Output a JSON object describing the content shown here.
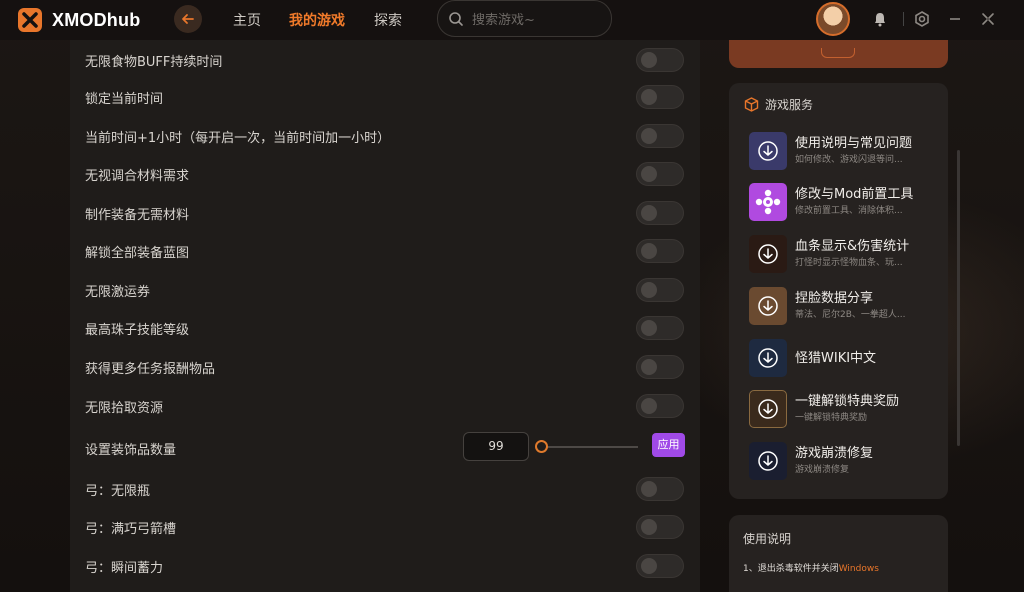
{
  "app": {
    "name": "XMODhub"
  },
  "nav": {
    "home": "主页",
    "my_games": "我的游戏",
    "explore": "探索"
  },
  "search": {
    "placeholder": "搜索游戏~"
  },
  "cheats": [
    {
      "label": "无限食物BUFF持续时间"
    },
    {
      "label": "锁定当前时间"
    },
    {
      "label": "当前时间+1小时（每开启一次，当前时间加一小时）"
    },
    {
      "label": "无视调合材料需求"
    },
    {
      "label": "制作装备无需材料"
    },
    {
      "label": "解锁全部装备蓝图"
    },
    {
      "label": "无限激运券"
    },
    {
      "label": "最高珠子技能等级"
    },
    {
      "label": "获得更多任务报酬物品"
    },
    {
      "label": "无限拾取资源"
    }
  ],
  "slider_row": {
    "label": "设置装饰品数量",
    "value": "99",
    "apply_label": "应用"
  },
  "cheats_bottom": [
    {
      "label": "弓：无限瓶"
    },
    {
      "label": "弓：满巧弓箭槽"
    },
    {
      "label": "弓：瞬间蓄力"
    }
  ],
  "services": {
    "title": "游戏服务",
    "items": [
      {
        "title": "使用说明与常见问题",
        "subtitle": "如何修改、游戏闪退等问...",
        "icon_bg": "#3a3a6a"
      },
      {
        "title": "修改与Mod前置工具",
        "subtitle": "修改前置工具、消除体积...",
        "icon_bg": "#b04ae0"
      },
      {
        "title": "血条显示&伤害统计",
        "subtitle": "打怪时显示怪物血条、玩...",
        "icon_bg": "#2a1a14"
      },
      {
        "title": "捏脸数据分享",
        "subtitle": "蒂法、尼尔2B、一拳超人...",
        "icon_bg": "#6a4a30"
      },
      {
        "title": "怪猎WIKI中文",
        "subtitle": "",
        "icon_bg": "#1e2a40"
      },
      {
        "title": "一键解锁特典奖励",
        "subtitle": "一键解锁特典奖励",
        "icon_bg": "#3a2a1c"
      },
      {
        "title": "游戏崩溃修复",
        "subtitle": "游戏崩溃修复",
        "icon_bg": "#1a1e30"
      }
    ]
  },
  "usage": {
    "title": "使用说明",
    "step1": "1、退出杀毒软件并关闭",
    "step1_highlight": "Windows"
  }
}
